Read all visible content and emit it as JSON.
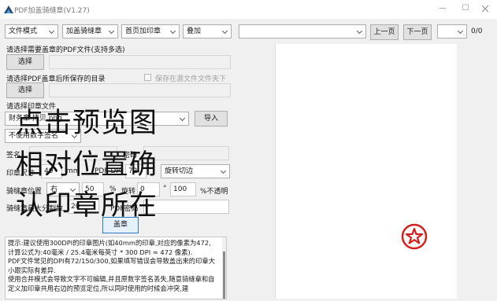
{
  "window": {
    "title": "PDF加盖骑缝章(V1.27)",
    "minimize_glyph": "—",
    "maximize_glyph": "☐"
  },
  "toolbar": {
    "file_mode": "文件模式",
    "stamp_mode": "加盖骑缝章",
    "first_page": "首页加印章",
    "overlay": "叠加",
    "page_select": "",
    "prev_page": "上一页",
    "next_page": "下一页",
    "zoom_select": "",
    "page_counter": "0/0"
  },
  "pdf_select": {
    "label": "请选择需要盖章的PDF文件(支持多选)",
    "button": "选择",
    "path": ""
  },
  "save_dir": {
    "label": "请选择PDF盖章后所保存的目录",
    "checkbox_label": "保存在源文件文件夹下",
    "checked": false,
    "button": "选择",
    "path": ""
  },
  "stamp_file": {
    "label": "请选择印章文件",
    "value": "财务章 拷贝.png",
    "import_button": "导入"
  },
  "signature": {
    "mode": "不使用数字签名",
    "name_label": "签名",
    "name_value": "",
    "password_label": "密码",
    "password_value": ""
  },
  "stamp_size": {
    "label": "印章尺寸",
    "value": "40",
    "unit": "mm",
    "dpi_label": "PDF DPI",
    "dpi_value": "72",
    "edge": "旋转切边"
  },
  "seam_position": {
    "label": "骑缝章位置",
    "side": "右",
    "percent": "50",
    "percent_unit": "%",
    "rotate_label": "旋转",
    "rotate_value": "0",
    "degree_unit": "°",
    "opacity_value": "100",
    "opacity_unit": "%不透明"
  },
  "seam_max": {
    "label": "骑缝章最大分割数",
    "value": "20",
    "pdf_password_label": "PDF密码",
    "pdf_password_value": ""
  },
  "action": {
    "stamp_button": "盖章"
  },
  "info": {
    "paragraphs": [
      "提示:建议使用300DPI的印章图片(如40mm的印章,对应的像素为472,计算公式为:40毫米 / 25.4毫米每英寸 * 300 DPI ≈ 472 像素).",
      "PDF文件常见的DPI有72/150/300,如果填写错误会导致盖出来的印章大小跟实际有差异.",
      "使用合并模式会导致文字不可编辑,并且原数字签名丢失,随意骑缝章和自定义加印章共用右边的预览定位,所以同时使用的时候会冲突,建"
    ]
  },
  "preview": {
    "lines": [
      "点击预览图",
      "相对位置确",
      "认印章所在"
    ],
    "stamp_color": "#d21f1f"
  }
}
